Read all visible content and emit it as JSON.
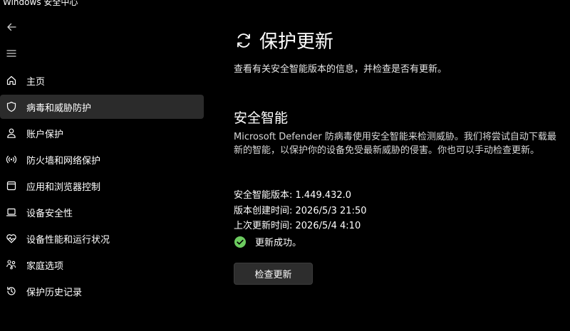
{
  "window": {
    "title": "Windows 安全中心"
  },
  "sidebar": {
    "back_icon": "back-arrow-icon",
    "menu_icon": "hamburger-menu-icon",
    "items": [
      {
        "label": "主页",
        "icon": "home-icon"
      },
      {
        "label": "病毒和威胁防护",
        "icon": "shield-icon",
        "selected": true
      },
      {
        "label": "账户保护",
        "icon": "person-icon"
      },
      {
        "label": "防火墙和网络保护",
        "icon": "wifi-signal-icon"
      },
      {
        "label": "应用和浏览器控制",
        "icon": "app-window-icon"
      },
      {
        "label": "设备安全性",
        "icon": "laptop-icon"
      },
      {
        "label": "设备性能和运行状况",
        "icon": "heart-pulse-icon"
      },
      {
        "label": "家庭选项",
        "icon": "family-icon"
      },
      {
        "label": "保护历史记录",
        "icon": "history-icon"
      }
    ]
  },
  "main": {
    "title": "保护更新",
    "title_icon": "refresh-icon",
    "description": "查看有关安全智能版本的信息，并检查是否有更新。",
    "section": {
      "title": "安全智能",
      "description": "Microsoft Defender 防病毒使用安全智能来检测威胁。我们将尝试自动下载最新的智能，以保护你的设备免受最新威胁的侵害。你也可以手动检查更新。",
      "version_line": "安全智能版本: 1.449.432.0",
      "created_line": "版本创建时间: 2026/5/3 21:50",
      "updated_line": "上次更新时间: 2026/5/4 4:10",
      "status_text": "更新成功。",
      "status_icon": "success-check-icon",
      "check_button": "检查更新"
    }
  },
  "colors": {
    "background": "#000000",
    "selected_item": "#2b2b2b",
    "success": "#6ccb5f",
    "button_bg": "#2d2d2d"
  }
}
